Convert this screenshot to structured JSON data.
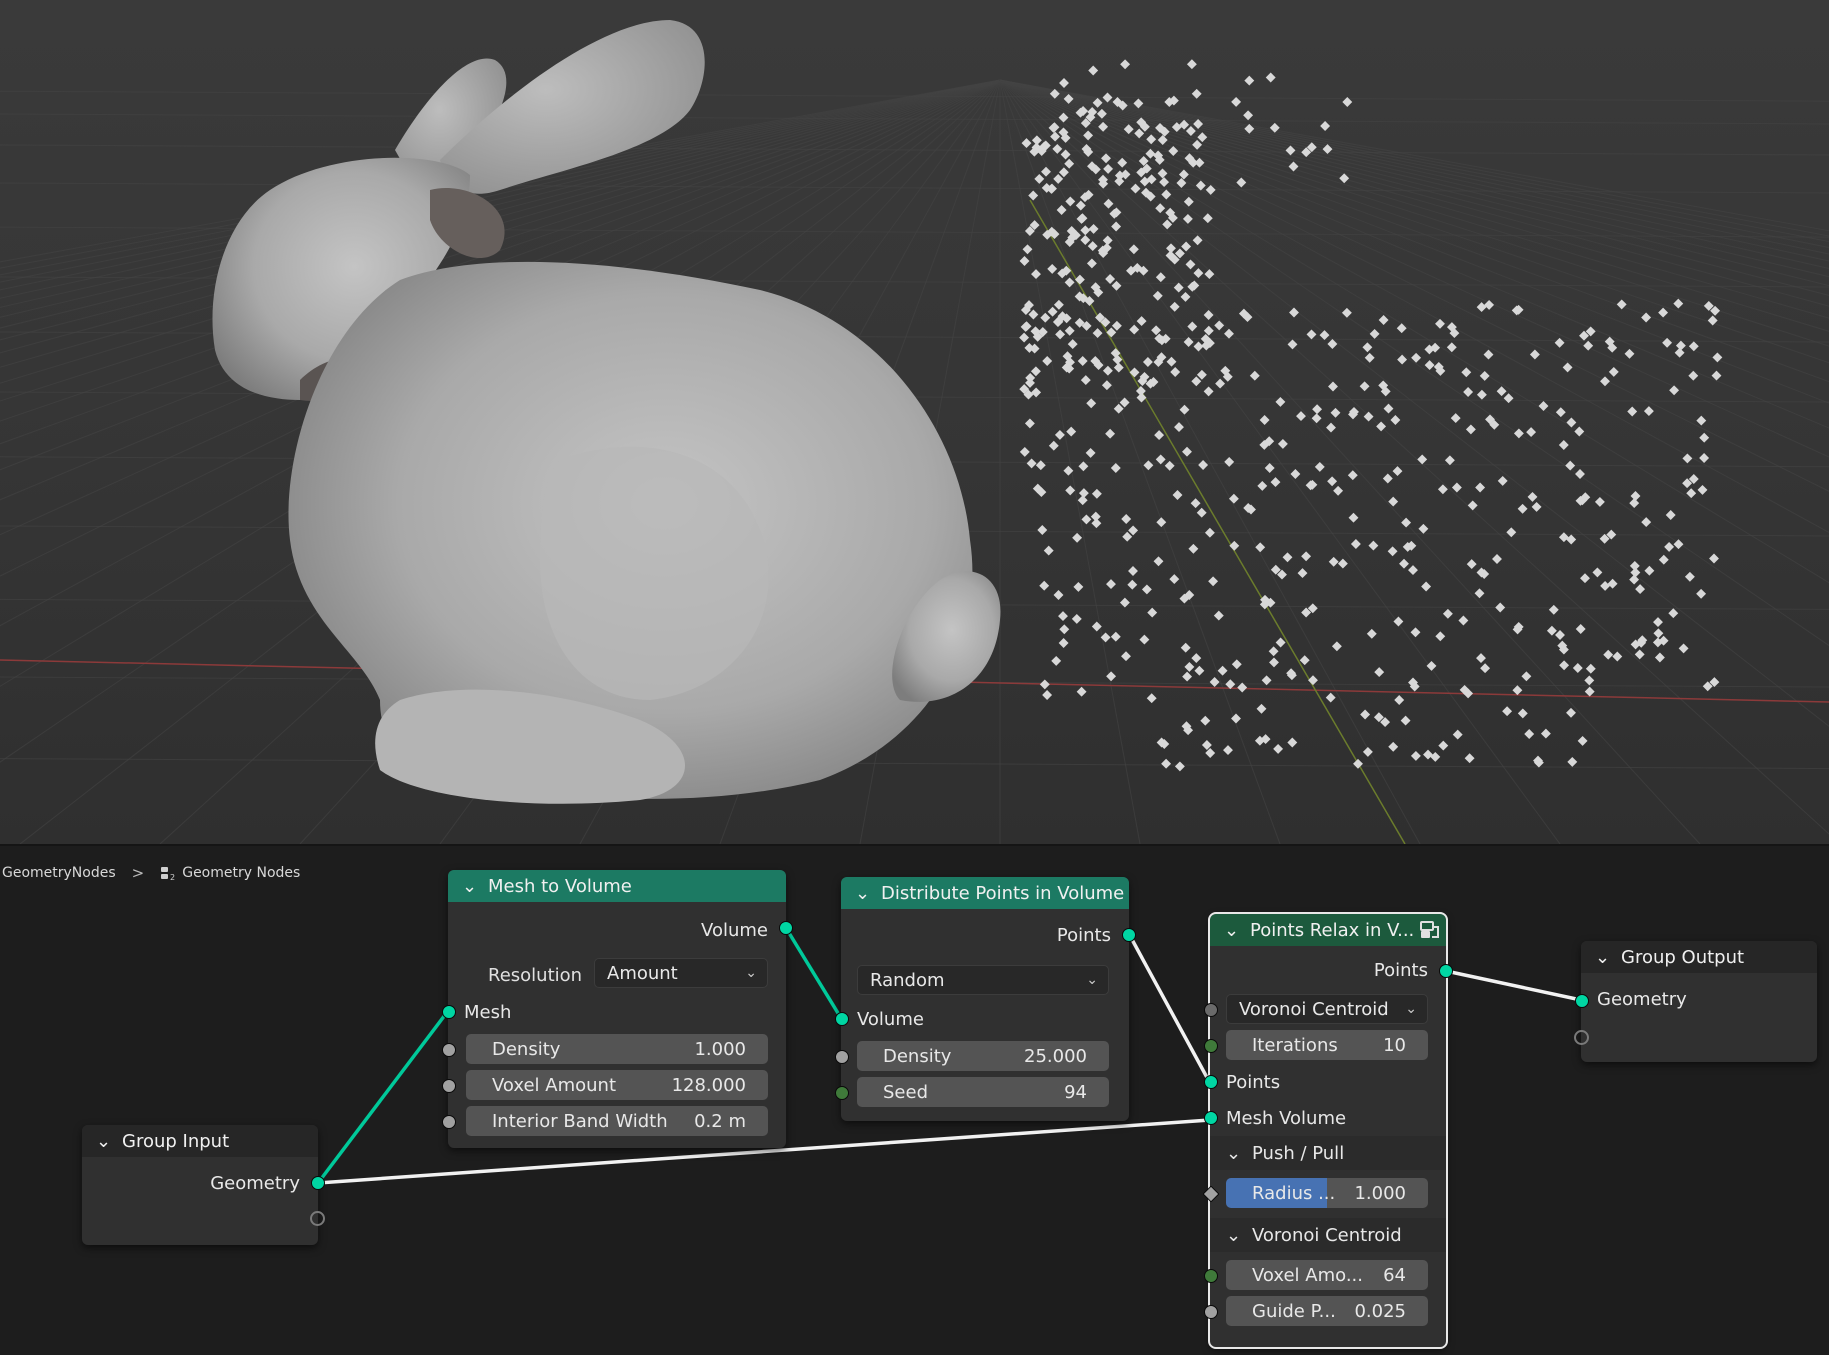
{
  "breadcrumb": {
    "root": "GeometryNodes",
    "separator": ">",
    "current": "Geometry Nodes",
    "current_icon": "node-tree-icon"
  },
  "nodes": {
    "mesh_to_volume": {
      "title": "Mesh to Volume",
      "output_volume": "Volume",
      "resolution_label": "Resolution",
      "resolution_value": "Amount",
      "input_mesh": "Mesh",
      "density_label": "Density",
      "density_value": "1.000",
      "voxel_amount_label": "Voxel Amount",
      "voxel_amount_value": "128.000",
      "band_label": "Interior Band Width",
      "band_value": "0.2 m"
    },
    "distribute": {
      "title": "Distribute Points in Volume",
      "output_points": "Points",
      "mode_value": "Random",
      "input_volume": "Volume",
      "density_label": "Density",
      "density_value": "25.000",
      "seed_label": "Seed",
      "seed_value": "94"
    },
    "relax": {
      "title": "Points Relax in V...",
      "output_points": "Points",
      "mode_value": "Voronoi Centroid",
      "iterations_label": "Iterations",
      "iterations_value": "10",
      "input_points": "Points",
      "input_mesh_volume": "Mesh Volume",
      "panel_push_pull": "Push / Pull",
      "radius_label": "Radius ...",
      "radius_value": "1.000",
      "radius_fraction": 0.5,
      "panel_voronoi": "Voronoi Centroid",
      "voxel_label": "Voxel Amo...",
      "voxel_value": "64",
      "guide_label": "Guide P...",
      "guide_value": "0.025"
    },
    "group_input": {
      "title": "Group Input",
      "output_geometry": "Geometry"
    },
    "group_output": {
      "title": "Group Output",
      "input_geometry": "Geometry"
    }
  },
  "colors": {
    "geometry_socket": "#00d6a3",
    "float_socket": "#a1a1a1",
    "int_socket": "#3f7a3a",
    "geometry_header": "#1c7a63",
    "viewport_bg": "#393939",
    "mesh_gray": "#a8a8a8"
  }
}
